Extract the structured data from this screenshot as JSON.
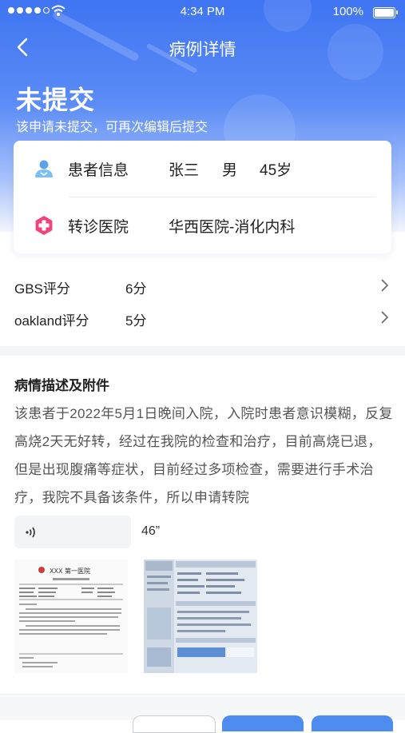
{
  "status_bar": {
    "time": "4:34 PM",
    "battery_text": "100%",
    "signal_icon": "signal-dots-icon",
    "wifi_icon": "wifi-icon",
    "battery_icon": "battery-icon"
  },
  "nav": {
    "title": "病例详情",
    "back_icon": "chevron-left-icon"
  },
  "case_status": {
    "title": "未提交",
    "subtitle": "该申请未提交，可再次编辑后提交"
  },
  "info_card": {
    "patient": {
      "icon": "patient-icon",
      "label": "患者信息",
      "name": "张三",
      "gender": "男",
      "age": "45岁"
    },
    "hospital": {
      "icon": "medical-cross-icon",
      "label": "转诊医院",
      "value": "华西医院-消化内科"
    }
  },
  "scores": [
    {
      "label": "GBS评分",
      "value": "6分"
    },
    {
      "label": "oakland评分",
      "value": "5分"
    }
  ],
  "description": {
    "section_title": "病情描述及附件",
    "text": "该患者于2022年5月1日晚间入院，入院时患者意识模糊，反复高烧2天无好转，经过在我院的检查和治疗，目前高烧已退，但是出现腹痛等症状，目前经过多项检查，需要进行手术治疗，我院不具备该条件，所以申请转院"
  },
  "attachments": {
    "voice_duration": "46”",
    "doc_header": "XXX 第一医院"
  },
  "colors": {
    "primary": "#3f74f2",
    "accent_pink": "#f0457a",
    "accent_blue": "#4f8cf0"
  }
}
